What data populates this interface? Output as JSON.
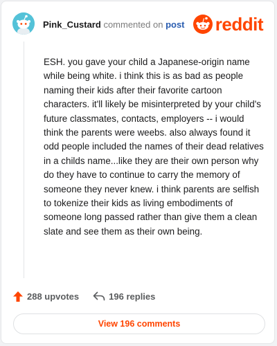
{
  "header": {
    "username": "Pink_Custard",
    "action_text": "commented on",
    "post_link": "post",
    "brand": "reddit"
  },
  "comment": {
    "body": "ESH. you gave your child a Japanese-origin name while being white. i think this is as bad as people naming their kids after their favorite cartoon characters. it'll likely be misinterpreted by your child's future classmates, contacts, employers -- i would think the parents were weebs. also always found it odd people included the names of their dead relatives in a childs name...like they are their own person why do they have to continue to carry the memory of someone they never knew. i think parents are selfish to tokenize their kids as living embodiments of someone long passed rather than give them a clean slate and see them as their own being."
  },
  "stats": {
    "upvotes": "288 upvotes",
    "replies": "196 replies"
  },
  "footer": {
    "view_comments": "View 196 comments"
  },
  "colors": {
    "brand": "#ff4500",
    "avatar_bg": "#54c2d8",
    "link": "#2a5db0"
  },
  "icons": [
    "snoo-avatar-icon",
    "reddit-logo-icon",
    "upvote-arrow-icon",
    "reply-arrow-icon"
  ]
}
